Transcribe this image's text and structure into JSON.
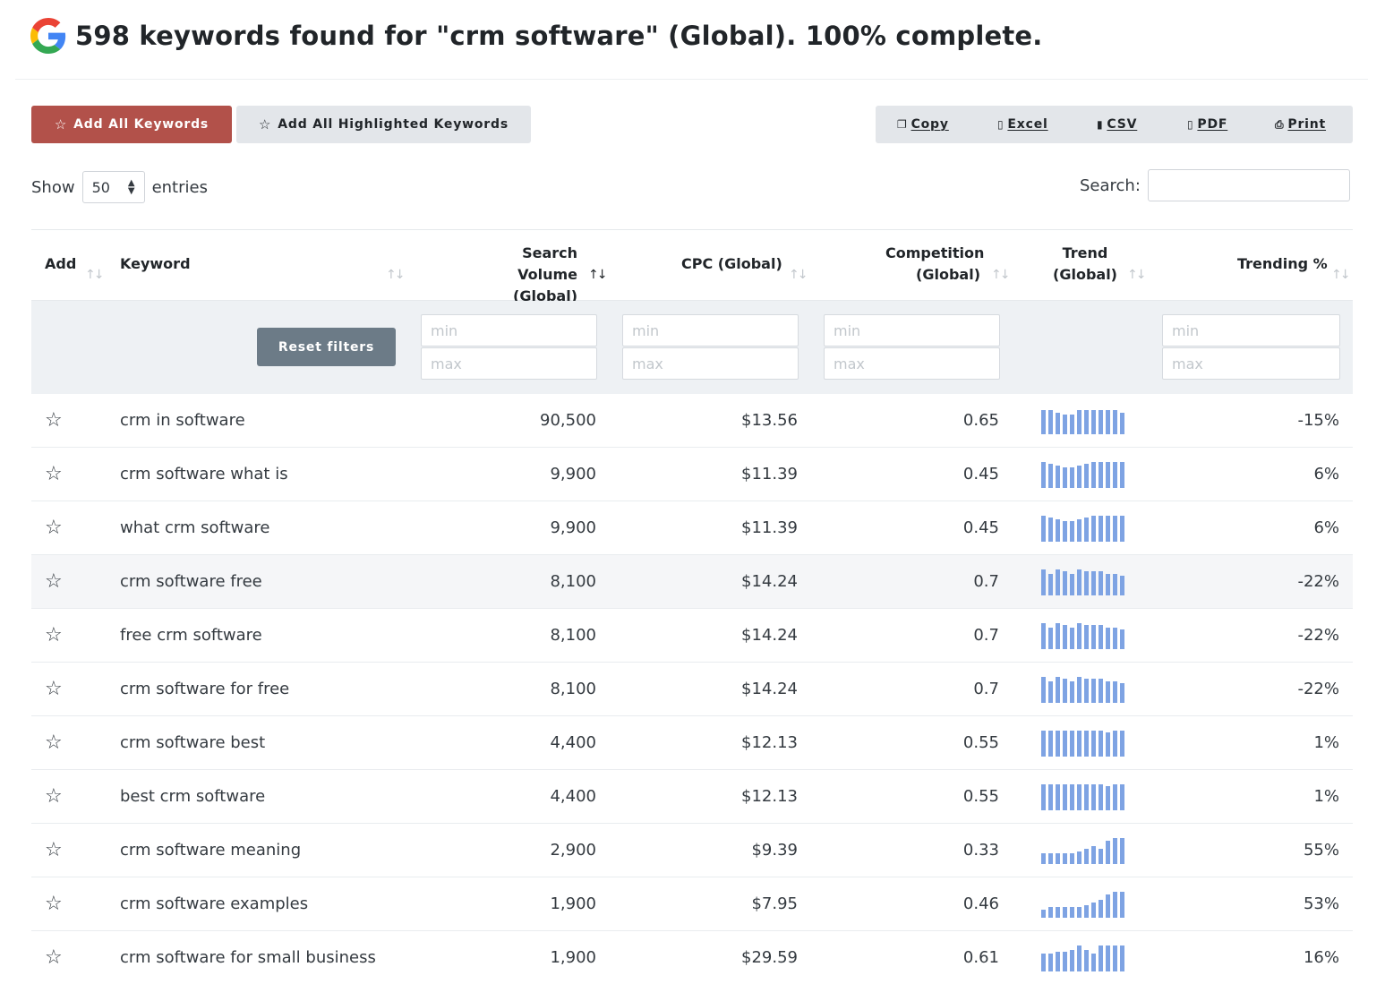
{
  "header": {
    "title": "598 keywords found for \"crm software\" (Global). 100% complete."
  },
  "buttons": {
    "add_all": "Add All Keywords",
    "add_highlighted": "Add All Highlighted Keywords"
  },
  "export": {
    "copy": "Copy",
    "excel": "Excel",
    "csv": "CSV",
    "pdf": "PDF",
    "print": "Print"
  },
  "length": {
    "show": "Show",
    "value": "50",
    "entries": "entries"
  },
  "search": {
    "label": "Search:"
  },
  "columns": {
    "add": "Add",
    "keyword": "Keyword",
    "volume_1": "Search Volume",
    "volume_2": "(Global)",
    "cpc": "CPC (Global)",
    "comp_1": "Competition",
    "comp_2": "(Global)",
    "trend_1": "Trend",
    "trend_2": "(Global)",
    "trending": "Trending %"
  },
  "filters": {
    "reset": "Reset filters",
    "min": "min",
    "max": "max"
  },
  "rows": [
    {
      "keyword": "crm in software",
      "volume": "90,500",
      "cpc": "$13.56",
      "competition": "0.65",
      "trending": "-15%",
      "trend": [
        27,
        27,
        24,
        22,
        22,
        27,
        27,
        27,
        27,
        27,
        27,
        24
      ]
    },
    {
      "keyword": "crm software what is",
      "volume": "9,900",
      "cpc": "$11.39",
      "competition": "0.45",
      "trending": "6%",
      "trend": [
        29,
        27,
        25,
        23,
        23,
        25,
        27,
        29,
        29,
        29,
        29,
        29
      ]
    },
    {
      "keyword": "what crm software",
      "volume": "9,900",
      "cpc": "$11.39",
      "competition": "0.45",
      "trending": "6%",
      "trend": [
        29,
        27,
        25,
        23,
        23,
        25,
        27,
        29,
        29,
        29,
        29,
        29
      ]
    },
    {
      "keyword": "crm software free",
      "volume": "8,100",
      "cpc": "$14.24",
      "competition": "0.7",
      "trending": "-22%",
      "trend": [
        29,
        24,
        29,
        27,
        24,
        29,
        27,
        27,
        27,
        24,
        24,
        22
      ]
    },
    {
      "keyword": "free crm software",
      "volume": "8,100",
      "cpc": "$14.24",
      "competition": "0.7",
      "trending": "-22%",
      "trend": [
        29,
        24,
        29,
        27,
        24,
        29,
        27,
        27,
        27,
        24,
        24,
        22
      ]
    },
    {
      "keyword": "crm software for free",
      "volume": "8,100",
      "cpc": "$14.24",
      "competition": "0.7",
      "trending": "-22%",
      "trend": [
        29,
        24,
        29,
        27,
        24,
        29,
        27,
        27,
        27,
        24,
        24,
        22
      ]
    },
    {
      "keyword": "crm software best",
      "volume": "4,400",
      "cpc": "$12.13",
      "competition": "0.55",
      "trending": "1%",
      "trend": [
        29,
        29,
        29,
        29,
        29,
        29,
        29,
        29,
        29,
        27,
        29,
        29
      ]
    },
    {
      "keyword": "best crm software",
      "volume": "4,400",
      "cpc": "$12.13",
      "competition": "0.55",
      "trending": "1%",
      "trend": [
        29,
        29,
        29,
        29,
        29,
        29,
        29,
        29,
        29,
        27,
        29,
        29
      ]
    },
    {
      "keyword": "crm software meaning",
      "volume": "2,900",
      "cpc": "$9.39",
      "competition": "0.33",
      "trending": "55%",
      "trend": [
        12,
        12,
        12,
        12,
        12,
        14,
        17,
        20,
        17,
        26,
        29,
        29
      ]
    },
    {
      "keyword": "crm software examples",
      "volume": "1,900",
      "cpc": "$7.95",
      "competition": "0.46",
      "trending": "53%",
      "trend": [
        9,
        12,
        12,
        12,
        12,
        12,
        14,
        17,
        20,
        26,
        29,
        29
      ]
    },
    {
      "keyword": "crm software for small business",
      "volume": "1,900",
      "cpc": "$29.59",
      "competition": "0.61",
      "trending": "16%",
      "trend": [
        20,
        20,
        22,
        22,
        24,
        29,
        24,
        20,
        29,
        29,
        29,
        29
      ]
    }
  ],
  "colors": {
    "primary_button": "#b2514a",
    "trend_bar": "#7ea3e3",
    "reset_button": "#6c7b87"
  }
}
